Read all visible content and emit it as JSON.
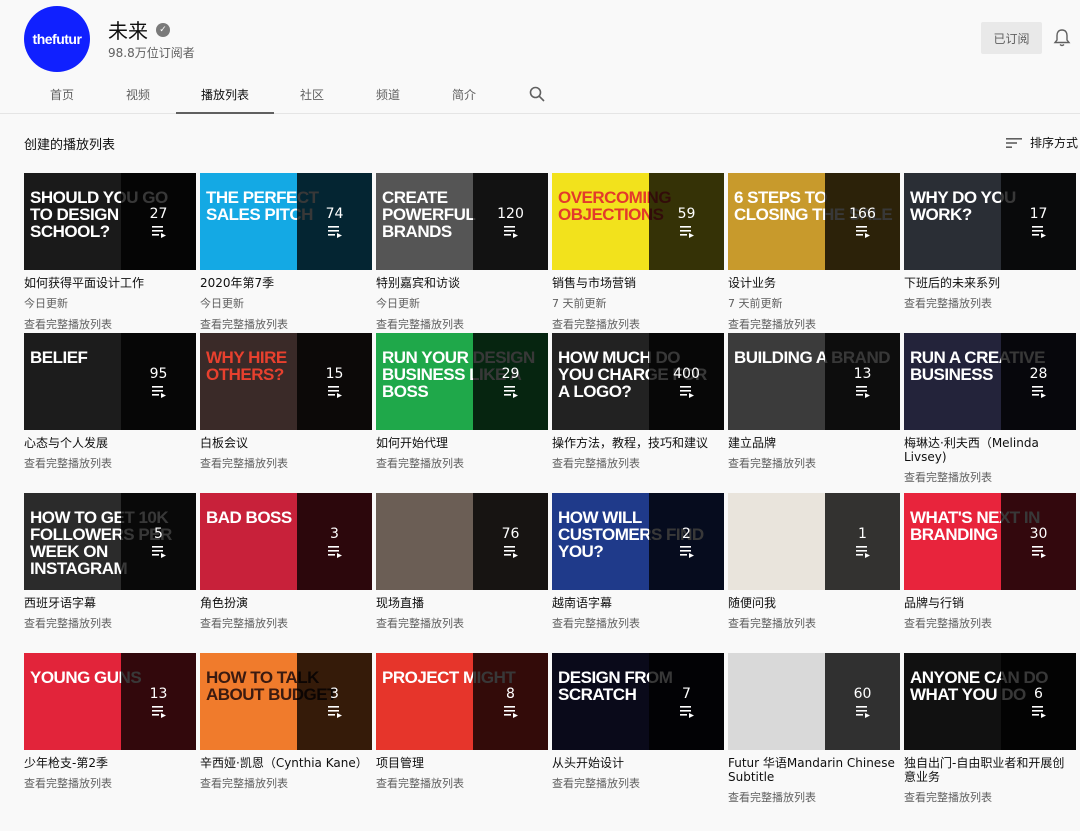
{
  "channel": {
    "avatar_text": "thefutur",
    "name": "未来",
    "subscribers": "98.8万位订阅者",
    "subscribed_label": "已订阅"
  },
  "tabs": [
    "首页",
    "视频",
    "播放列表",
    "社区",
    "频道",
    "简介"
  ],
  "active_tab": "播放列表",
  "section": {
    "title": "创建的播放列表",
    "sort_label": "排序方式"
  },
  "view_full_label": "查看完整播放列表",
  "playlists": [
    {
      "title": "如何获得平面设计工作",
      "count": "27",
      "updated": "今日更新",
      "thumb_text": "Should you go to design school?",
      "bg": "#1a1a1a",
      "fg": "#ffffff"
    },
    {
      "title": "2020年第7季",
      "count": "74",
      "updated": "今日更新",
      "thumb_text": "The perfect sales pitch",
      "bg": "#14a9e4",
      "fg": "#ffffff"
    },
    {
      "title": "特别嘉宾和访谈",
      "count": "120",
      "updated": "今日更新",
      "thumb_text": "Create powerful brands",
      "bg": "#555555",
      "fg": "#ffffff"
    },
    {
      "title": "销售与市场营销",
      "count": "59",
      "updated": "7 天前更新",
      "thumb_text": "Overcoming objections",
      "bg": "#f2e21c",
      "fg": "#e33a2b"
    },
    {
      "title": "设计业务",
      "count": "166",
      "updated": "7 天前更新",
      "thumb_text": "6 steps to closing the sale",
      "bg": "#c89a2c",
      "fg": "#ffffff"
    },
    {
      "title": "下班后的未来系列",
      "count": "17",
      "updated": "",
      "thumb_text": "Why do you work?",
      "bg": "#2a2e35",
      "fg": "#ffffff"
    },
    {
      "title": "心态与个人发展",
      "count": "95",
      "updated": "",
      "thumb_text": "Belief",
      "bg": "#1c1c1c",
      "fg": "#ffffff"
    },
    {
      "title": "白板会议",
      "count": "15",
      "updated": "",
      "thumb_text": "Why hire others?",
      "bg": "#3a2a28",
      "fg": "#e8402e"
    },
    {
      "title": "如何开始代理",
      "count": "29",
      "updated": "",
      "thumb_text": "Run your design business like a boss",
      "bg": "#1fa84a",
      "fg": "#ffffff"
    },
    {
      "title": "操作方法，教程，技巧和建议",
      "count": "400",
      "updated": "",
      "thumb_text": "How much do you charge for a logo?",
      "bg": "#222222",
      "fg": "#ffffff"
    },
    {
      "title": "建立品牌",
      "count": "13",
      "updated": "",
      "thumb_text": "Building a brand",
      "bg": "#3b3b3b",
      "fg": "#ffffff"
    },
    {
      "title": "梅琳达·利夫西（Melinda Livsey)",
      "count": "28",
      "updated": "",
      "thumb_text": "Run a creative business",
      "bg": "#23233a",
      "fg": "#ffffff"
    },
    {
      "title": "西班牙语字幕",
      "count": "5",
      "updated": "",
      "thumb_text": "How to get 10k followers per week on Instagram",
      "bg": "#2b2b2b",
      "fg": "#ffffff"
    },
    {
      "title": "角色扮演",
      "count": "3",
      "updated": "",
      "thumb_text": "Bad boss",
      "bg": "#c8213a",
      "fg": "#ffffff"
    },
    {
      "title": "现场直播",
      "count": "76",
      "updated": "",
      "thumb_text": "",
      "bg": "#6b5e55",
      "fg": "#ffffff"
    },
    {
      "title": "越南语字幕",
      "count": "2",
      "updated": "",
      "thumb_text": "How will customers find you?",
      "bg": "#1f3a8a",
      "fg": "#ffffff"
    },
    {
      "title": "随便问我",
      "count": "1",
      "updated": "",
      "thumb_text": "",
      "bg": "#e9e4dc",
      "fg": "#222222"
    },
    {
      "title": "品牌与行销",
      "count": "30",
      "updated": "",
      "thumb_text": "What's next in branding",
      "bg": "#e8243c",
      "fg": "#ffffff"
    },
    {
      "title": "少年枪支-第2季",
      "count": "13",
      "updated": "",
      "thumb_text": "Young guns",
      "bg": "#e2243a",
      "fg": "#ffffff"
    },
    {
      "title": "辛西娅·凯恩（Cynthia Kane）",
      "count": "3",
      "updated": "",
      "thumb_text": "How to talk about budget",
      "bg": "#f07b2c",
      "fg": "#3a1a10"
    },
    {
      "title": "项目管理",
      "count": "8",
      "updated": "",
      "thumb_text": "Project might",
      "bg": "#e6352b",
      "fg": "#ffffff"
    },
    {
      "title": "从头开始设计",
      "count": "7",
      "updated": "",
      "thumb_text": "Design from scratch",
      "bg": "#0a0a1a",
      "fg": "#ffffff"
    },
    {
      "title": "Futur 华语Mandarin Chinese Subtitle",
      "count": "60",
      "updated": "",
      "thumb_text": "",
      "bg": "#d9d9d9",
      "fg": "#222222"
    },
    {
      "title": "独自出门-自由职业者和开展创意业务",
      "count": "6",
      "updated": "",
      "thumb_text": "Anyone can do what you do",
      "bg": "#111111",
      "fg": "#ffffff"
    }
  ]
}
